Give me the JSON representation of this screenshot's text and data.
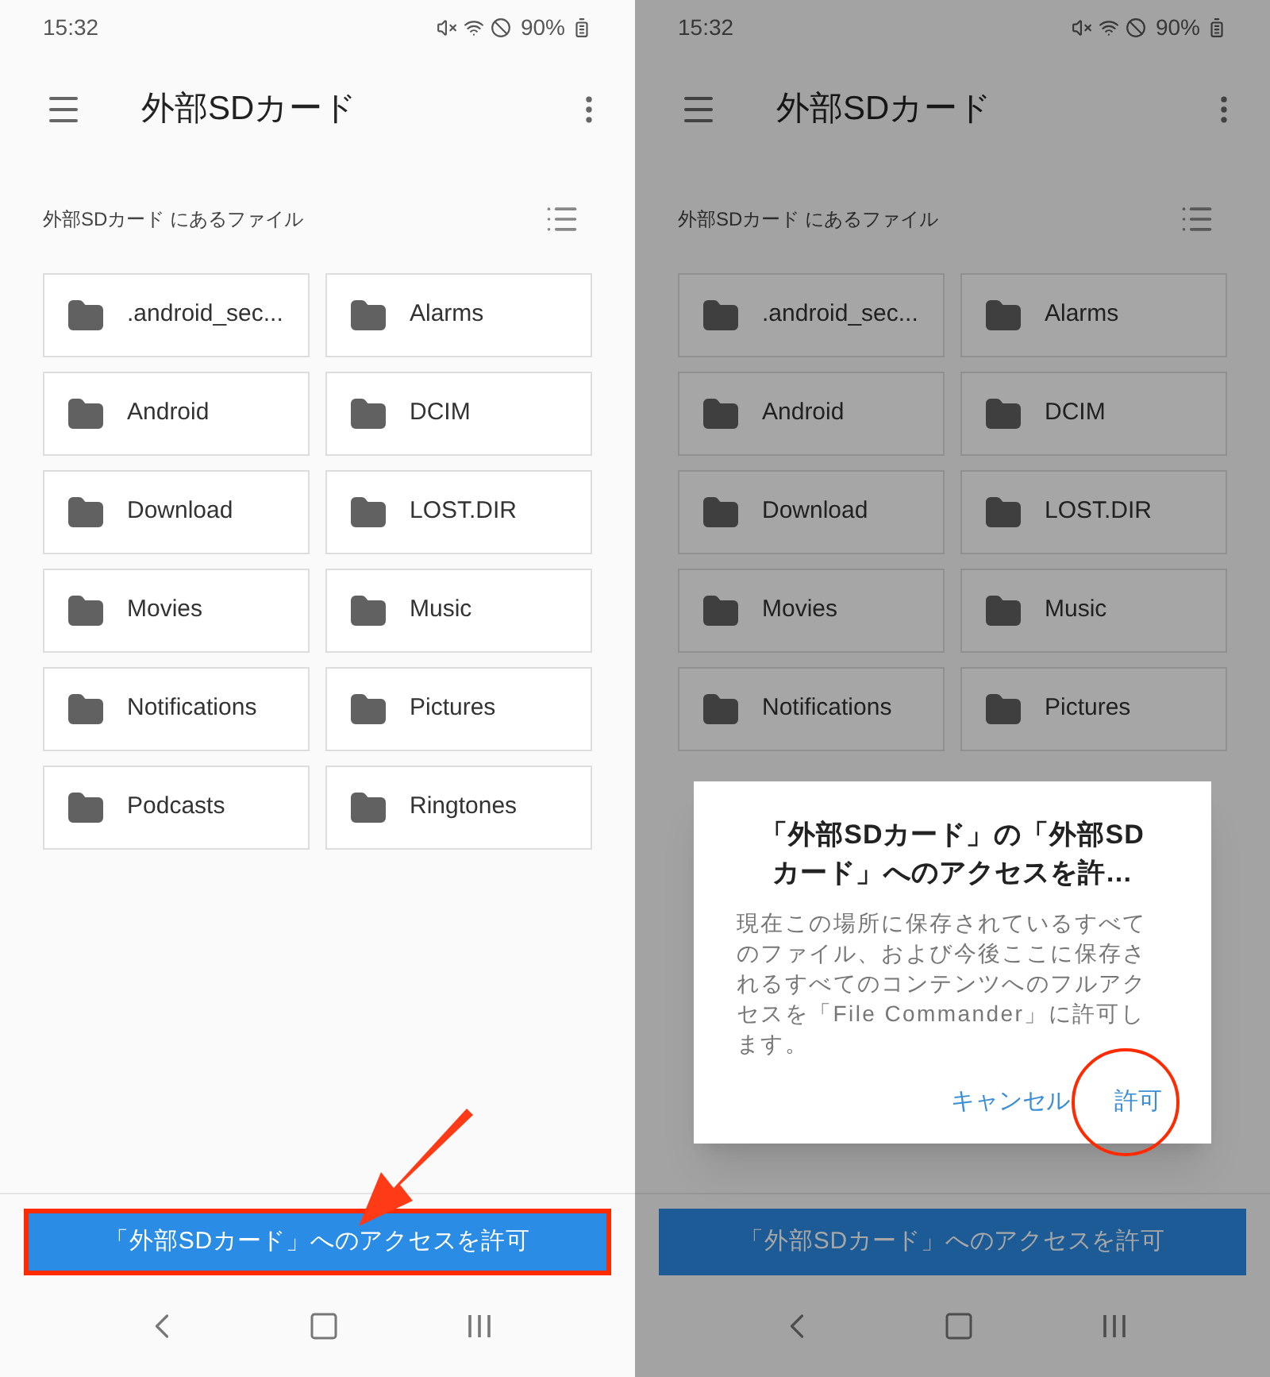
{
  "screens": [
    {
      "status_bar": {
        "time": "15:32",
        "battery": "90%"
      },
      "toolbar": {
        "title": "外部SDカード"
      },
      "location_label": "外部SDカード にあるファイル",
      "folders": [
        {
          "name": ".android_sec..."
        },
        {
          "name": "Alarms"
        },
        {
          "name": "Android"
        },
        {
          "name": "DCIM"
        },
        {
          "name": "Download"
        },
        {
          "name": "LOST.DIR"
        },
        {
          "name": "Movies"
        },
        {
          "name": "Music"
        },
        {
          "name": "Notifications"
        },
        {
          "name": "Pictures"
        },
        {
          "name": "Podcasts"
        },
        {
          "name": "Ringtones"
        }
      ],
      "grant_button": {
        "label": "「外部SDカード」へのアクセスを許可",
        "highlighted": true
      },
      "dimmed": false
    },
    {
      "status_bar": {
        "time": "15:32",
        "battery": "90%"
      },
      "toolbar": {
        "title": "外部SDカード"
      },
      "location_label": "外部SDカード にあるファイル",
      "folders": [
        {
          "name": ".android_sec..."
        },
        {
          "name": "Alarms"
        },
        {
          "name": "Android"
        },
        {
          "name": "DCIM"
        },
        {
          "name": "Download"
        },
        {
          "name": "LOST.DIR"
        },
        {
          "name": "Movies"
        },
        {
          "name": "Music"
        },
        {
          "name": "Notifications"
        },
        {
          "name": "Pictures"
        }
      ],
      "grant_button": {
        "label": "「外部SDカード」へのアクセスを許可",
        "highlighted": false
      },
      "dimmed": true,
      "dialog": {
        "title": "「外部SDカード」の「外部SDカード」へのアクセスを許…",
        "message": "現在この場所に保存されているすべてのファイル、および今後ここに保存されるすべてのコンテンツへのフルアクセスを「File Commander」に許可します。",
        "actions": [
          {
            "label": "キャンセル",
            "highlighted": false
          },
          {
            "label": "許可",
            "highlighted": true
          }
        ]
      }
    }
  ]
}
